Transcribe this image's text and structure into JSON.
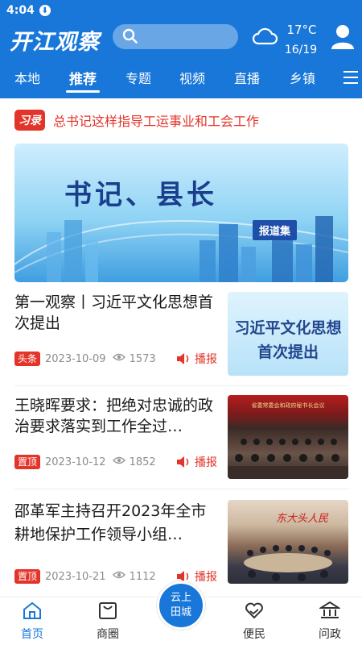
{
  "status": {
    "time": "4:04",
    "download_glyph": "⬇"
  },
  "header": {
    "logo": "开江观察",
    "search_placeholder": "",
    "weather": {
      "temp": "17°C",
      "date": "16/19",
      "icon": "cloud-icon"
    }
  },
  "tabs": [
    {
      "label": "本地",
      "active": false
    },
    {
      "label": "推荐",
      "active": true
    },
    {
      "label": "专题",
      "active": false
    },
    {
      "label": "视频",
      "active": false
    },
    {
      "label": "直播",
      "active": false
    },
    {
      "label": "乡镇",
      "active": false
    }
  ],
  "notice": {
    "badge": "习录",
    "text": "总书记这样指导工运事业和工会工作"
  },
  "banner": {
    "title": "书记、县长",
    "tag": "报道集"
  },
  "articles": [
    {
      "title": "第一观察丨习近平文化思想首次提出",
      "badge": "头条",
      "date": "2023-10-09",
      "views": "1573",
      "listen": "播报",
      "thumb_text": [
        "习近平文化思想",
        "首次提出"
      ]
    },
    {
      "title": "王晓晖要求：把绝对忠诚的政治要求落实到工作全过…",
      "badge": "置顶",
      "date": "2023-10-12",
      "views": "1852",
      "listen": "播报",
      "thumb_text": "省委常委会和政府秘书长会议"
    },
    {
      "title": "邵革军主持召开2023年全市耕地保护工作领导小组…",
      "badge": "置顶",
      "date": "2023-10-21",
      "views": "1112",
      "listen": "播报",
      "thumb_text": "东大头人民"
    }
  ],
  "bottom_nav": [
    {
      "label": "首页",
      "icon": "home-icon",
      "active": true
    },
    {
      "label": "商圈",
      "icon": "shop-icon",
      "active": false
    },
    {
      "label": "云上田城",
      "icon": "",
      "active": false
    },
    {
      "label": "便民",
      "icon": "heart-hand-icon",
      "active": false
    },
    {
      "label": "问政",
      "icon": "bank-icon",
      "active": false
    }
  ],
  "colors": {
    "primary": "#1877d9",
    "accent": "#e3342a"
  }
}
